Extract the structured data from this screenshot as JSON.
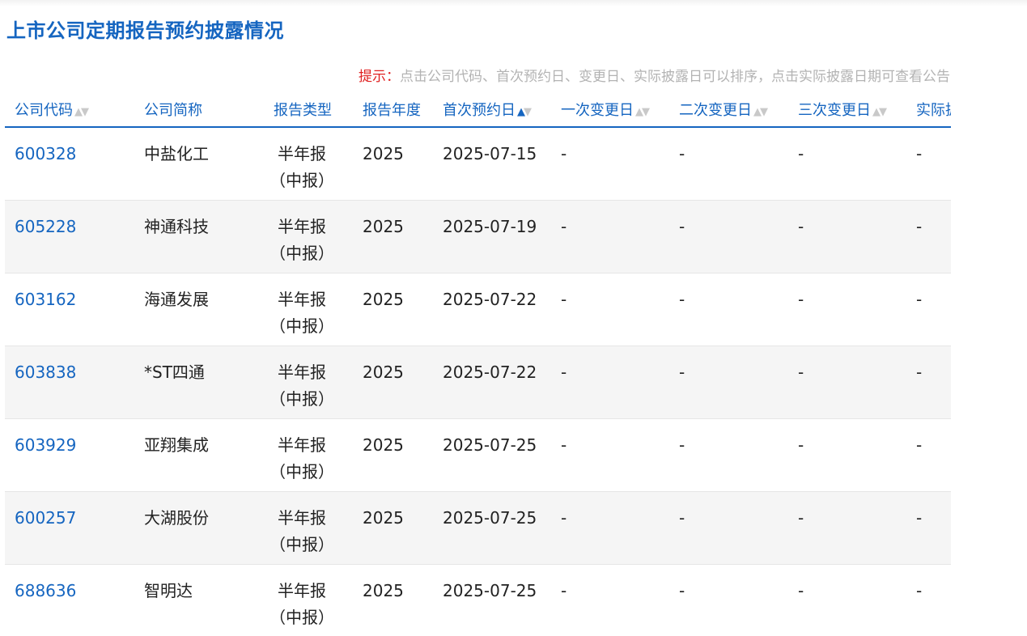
{
  "page": {
    "title": "上市公司定期报告预约披露情况"
  },
  "hint": {
    "label": "提示：",
    "text": "点击公司代码、首次预约日、变更日、实际披露日可以排序，点击实际披露日期可查看公告"
  },
  "table": {
    "columns": [
      {
        "label": "公司代码",
        "sortable": true
      },
      {
        "label": "公司简称",
        "sortable": false
      },
      {
        "label": "报告类型",
        "sortable": false
      },
      {
        "label": "报告年度",
        "sortable": false
      },
      {
        "label": "首次预约日",
        "sortable": true
      },
      {
        "label": "一次变更日",
        "sortable": true
      },
      {
        "label": "二次变更日",
        "sortable": true
      },
      {
        "label": "三次变更日",
        "sortable": true
      },
      {
        "label": "实际披",
        "sortable": false
      }
    ],
    "sort_up": "▲",
    "sort_down": "▼",
    "rows": [
      {
        "code": "600328",
        "name": "中盐化工",
        "type1": "半年报",
        "type2": "（中报）",
        "year": "2025",
        "first": "2025-07-15",
        "c1": "-",
        "c2": "-",
        "c3": "-",
        "actual": "-"
      },
      {
        "code": "605228",
        "name": "神通科技",
        "type1": "半年报",
        "type2": "（中报）",
        "year": "2025",
        "first": "2025-07-19",
        "c1": "-",
        "c2": "-",
        "c3": "-",
        "actual": "-"
      },
      {
        "code": "603162",
        "name": "海通发展",
        "type1": "半年报",
        "type2": "（中报）",
        "year": "2025",
        "first": "2025-07-22",
        "c1": "-",
        "c2": "-",
        "c3": "-",
        "actual": "-"
      },
      {
        "code": "603838",
        "name": "*ST四通",
        "type1": "半年报",
        "type2": "（中报）",
        "year": "2025",
        "first": "2025-07-22",
        "c1": "-",
        "c2": "-",
        "c3": "-",
        "actual": "-"
      },
      {
        "code": "603929",
        "name": "亚翔集成",
        "type1": "半年报",
        "type2": "（中报）",
        "year": "2025",
        "first": "2025-07-25",
        "c1": "-",
        "c2": "-",
        "c3": "-",
        "actual": "-"
      },
      {
        "code": "600257",
        "name": "大湖股份",
        "type1": "半年报",
        "type2": "（中报）",
        "year": "2025",
        "first": "2025-07-25",
        "c1": "-",
        "c2": "-",
        "c3": "-",
        "actual": "-"
      },
      {
        "code": "688636",
        "name": "智明达",
        "type1": "半年报",
        "type2": "（中报）",
        "year": "2025",
        "first": "2025-07-25",
        "c1": "-",
        "c2": "-",
        "c3": "-",
        "actual": "-"
      }
    ]
  },
  "colors": {
    "accent": "#1565c0",
    "hint_label": "#e02020",
    "hint_text": "#b3b3b3",
    "row_alt": "#f5f5f5"
  }
}
